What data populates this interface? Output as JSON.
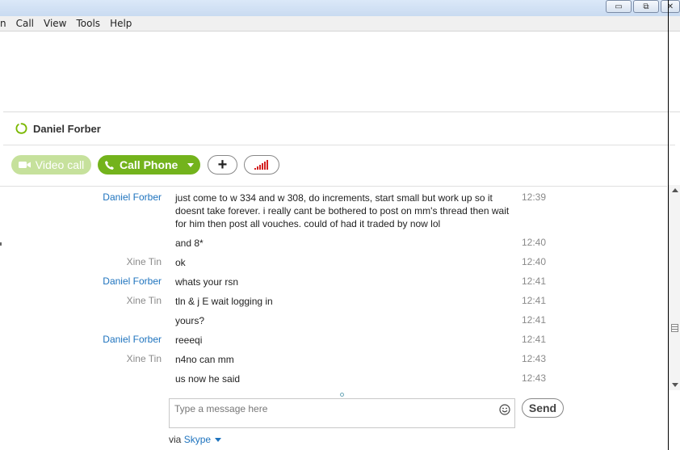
{
  "menu": {
    "items": [
      {
        "label": "n"
      },
      {
        "label": "Call"
      },
      {
        "label": "View"
      },
      {
        "label": "Tools"
      },
      {
        "label": "Help"
      }
    ]
  },
  "window_controls": {
    "minimize": "▭",
    "restore": "⧉",
    "close": "✕"
  },
  "contact": {
    "name": "Daniel Forber",
    "status_color": "#7ab800"
  },
  "toolbar": {
    "video_label": "Video call",
    "call_label": "Call Phone",
    "add_label": "+"
  },
  "messages": [
    {
      "sender": "Daniel Forber",
      "sender_color": "blue",
      "text": "just come to w 334 and w 308, do increments, start small but work up so it doesnt take forever. i really cant be bothered to post on mm's thread then wait for him then post all vouches. could of had it traded by now lol",
      "time": "12:39"
    },
    {
      "sender": "",
      "sender_color": "blue",
      "text": "and 8*",
      "time": "12:40"
    },
    {
      "sender": "Xine Tin",
      "sender_color": "gray",
      "text": "ok",
      "time": "12:40"
    },
    {
      "sender": "Daniel Forber",
      "sender_color": "blue",
      "text": "whats your rsn",
      "time": "12:41"
    },
    {
      "sender": "Xine Tin",
      "sender_color": "gray",
      "text": "tln & j E wait logging in",
      "time": "12:41"
    },
    {
      "sender": "",
      "sender_color": "gray",
      "text": "yours?",
      "time": "12:41"
    },
    {
      "sender": "Daniel Forber",
      "sender_color": "blue",
      "text": "reeeqi",
      "time": "12:41"
    },
    {
      "sender": "Xine Tin",
      "sender_color": "gray",
      "text": "n4no can mm",
      "time": "12:43"
    },
    {
      "sender": "",
      "sender_color": "gray",
      "text": "us now he said",
      "time": "12:43"
    }
  ],
  "compose": {
    "placeholder": "Type a message here",
    "send_label": "Send"
  },
  "via": {
    "prefix": "via",
    "service": "Skype"
  },
  "colors": {
    "accent_green": "#73b31c",
    "video_green": "#c6e19c",
    "link_blue": "#1e73be"
  }
}
